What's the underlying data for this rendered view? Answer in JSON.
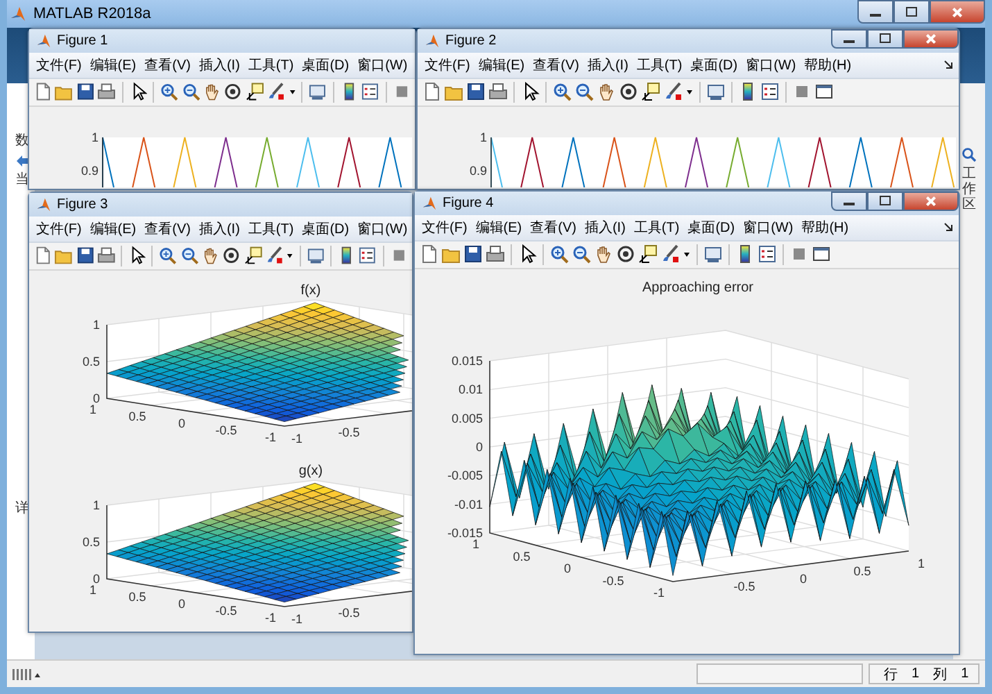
{
  "window": {
    "title": "MATLAB R2018a"
  },
  "left_panel": {
    "labels": [
      "数",
      "当"
    ],
    "detail_label": "详"
  },
  "right_panel": {
    "label": "工作区"
  },
  "figures": [
    {
      "title": "Figure 1",
      "menu": [
        "文件(F)",
        "编辑(E)",
        "查看(V)",
        "插入(I)",
        "工具(T)",
        "桌面(D)",
        "窗口(W)"
      ],
      "plots": [
        {
          "kind": "lines",
          "yticks": [
            "1",
            "0.9"
          ]
        }
      ]
    },
    {
      "title": "Figure 2",
      "menu": [
        "文件(F)",
        "编辑(E)",
        "查看(V)",
        "插入(I)",
        "工具(T)",
        "桌面(D)",
        "窗口(W)",
        "帮助(H)"
      ],
      "plots": [
        {
          "kind": "lines",
          "yticks": [
            "1",
            "0.9"
          ]
        }
      ]
    },
    {
      "title": "Figure 3",
      "menu": [
        "文件(F)",
        "编辑(E)",
        "查看(V)",
        "插入(I)",
        "工具(T)",
        "桌面(D)",
        "窗口(W)"
      ],
      "plots": [
        {
          "kind": "surface",
          "title": "f(x)",
          "zticks": [
            "1",
            "0.5",
            "0"
          ],
          "yticks": [
            "1",
            "0.5",
            "0",
            "-0.5",
            "-1"
          ],
          "xticks": [
            "-1",
            "-0.5"
          ]
        },
        {
          "kind": "surface",
          "title": "g(x)",
          "zticks": [
            "1",
            "0.5",
            "0"
          ],
          "yticks": [
            "1",
            "0.5",
            "0",
            "-0.5",
            "-1"
          ],
          "xticks": [
            "-1",
            "-0.5"
          ]
        }
      ]
    },
    {
      "title": "Figure 4",
      "menu": [
        "文件(F)",
        "编辑(E)",
        "查看(V)",
        "插入(I)",
        "工具(T)",
        "桌面(D)",
        "窗口(W)",
        "帮助(H)"
      ],
      "plots": [
        {
          "kind": "error",
          "title": "Approaching error",
          "zticks": [
            "0.015",
            "0.01",
            "0.005",
            "0",
            "-0.005",
            "-0.01",
            "-0.015"
          ],
          "yticks": [
            "1",
            "0.5",
            "0",
            "-0.5",
            "-1"
          ],
          "xticks": [
            "-0.5",
            "0",
            "0.5",
            "1"
          ]
        }
      ]
    }
  ],
  "status_bar": {
    "row_label": "行",
    "row": "1",
    "column_label": "列",
    "column": "1"
  }
}
